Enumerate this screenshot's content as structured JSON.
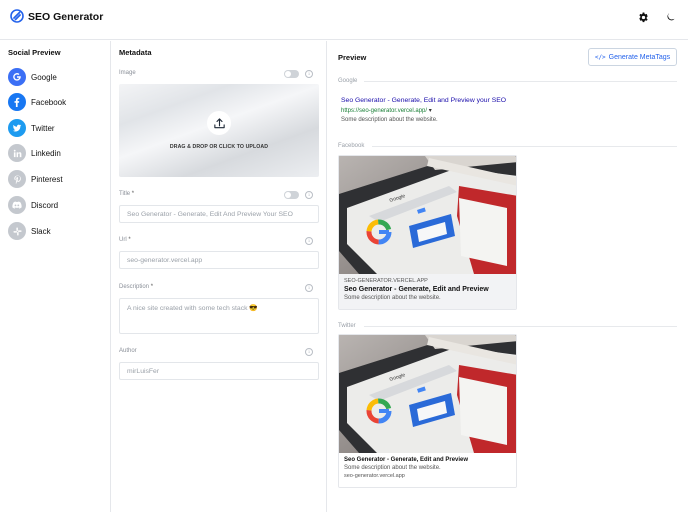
{
  "app": {
    "title": "SEO Generator",
    "logo_icon": "seo-generator-logo",
    "settings_icon": "gear-icon",
    "theme_icon": "moon-icon"
  },
  "sidebar": {
    "title": "Social Preview",
    "items": [
      {
        "label": "Google",
        "icon": "google-icon",
        "color": "#3b6ff5"
      },
      {
        "label": "Facebook",
        "icon": "facebook-icon",
        "color": "#1877f2"
      },
      {
        "label": "Twitter",
        "icon": "twitter-icon",
        "color": "#1d9bf0"
      },
      {
        "label": "Linkedin",
        "icon": "linkedin-icon",
        "color": "#c4c8ce"
      },
      {
        "label": "Pinterest",
        "icon": "pinterest-icon",
        "color": "#c4c8ce"
      },
      {
        "label": "Discord",
        "icon": "discord-icon",
        "color": "#c4c8ce"
      },
      {
        "label": "Slack",
        "icon": "slack-icon",
        "color": "#c4c8ce"
      }
    ]
  },
  "metadata": {
    "title": "Metadata",
    "image": {
      "label": "Image",
      "upload_text": "DRAG & DROP OR CLICK TO UPLOAD"
    },
    "title_field": {
      "label": "Title",
      "required_mark": "*",
      "placeholder": "Seo Generator - Generate, Edit And Preview Your SEO"
    },
    "url_field": {
      "label": "Url",
      "required_mark": "*",
      "placeholder": "seo-generator.vercel.app"
    },
    "description_field": {
      "label": "Description",
      "required_mark": "*",
      "placeholder": "A nice site created with some tech stack 😎"
    },
    "author_field": {
      "label": "Author",
      "placeholder": "mirLuisFer"
    }
  },
  "preview": {
    "title": "Preview",
    "generate_button": "Generate MetaTags",
    "google": {
      "section_label": "Google",
      "title": "Seo Generator - Generate, Edit and Preview your SEO",
      "url": "https://seo-generator.vercel.app/",
      "url_caret": "▾",
      "description": "Some description about the website."
    },
    "facebook": {
      "section_label": "Facebook",
      "domain": "SEO-GENERATOR.VERCEL.APP",
      "title": "Seo Generator - Generate, Edit and Preview",
      "description": "Some description about the website."
    },
    "twitter": {
      "section_label": "Twitter",
      "title": "Seo Generator - Generate, Edit and Preview",
      "description": "Some description about the website.",
      "domain": "seo-generator.vercel.app"
    },
    "image_logo_text": "Google"
  },
  "colors": {
    "accent": "#2563eb",
    "google_link": "#1a0dab",
    "google_url": "#1a7f37"
  }
}
